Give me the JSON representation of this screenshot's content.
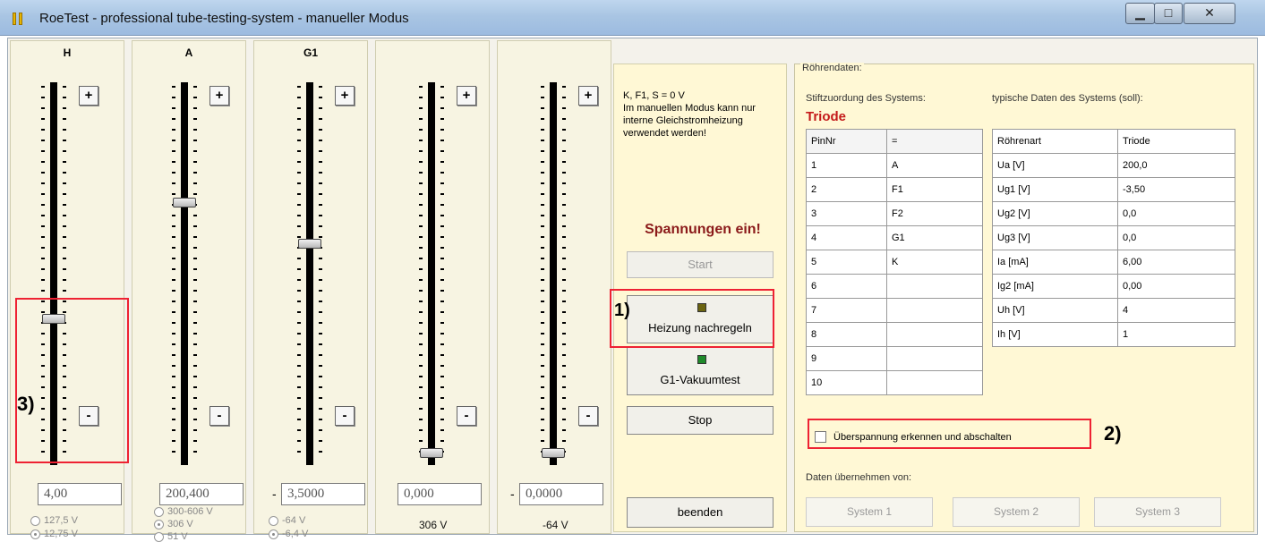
{
  "window": {
    "title": "RoeTest - professional tube-testing-system - manueller Modus",
    "close_symbol": "✕",
    "min_symbol": "▁",
    "max_symbol": "□"
  },
  "sliders": [
    {
      "label": "H",
      "value": "4,00",
      "sign": "",
      "level": 0.62,
      "plus": "+",
      "minus": "-"
    },
    {
      "label": "A",
      "value": "200,400",
      "sign": "",
      "level": 0.31,
      "plus": "+",
      "minus": "-"
    },
    {
      "label": "G1",
      "value": "3,5000",
      "sign": "-",
      "level": 0.42,
      "plus": "+",
      "minus": "-"
    },
    {
      "label": "",
      "value": "0,000",
      "sign": "",
      "level": 0.98,
      "plus": "+",
      "minus": "-"
    },
    {
      "label": "",
      "value": "0,0000",
      "sign": "-",
      "level": 0.98,
      "plus": "+",
      "minus": "-"
    }
  ],
  "ranges": {
    "h": [
      "127,5 V",
      "12,75 V"
    ],
    "a": [
      "300-606 V",
      "306 V",
      "51 V"
    ],
    "g1": [
      "-64 V",
      "-6,4 V"
    ],
    "s4": "306 V",
    "s5": "-64 V"
  },
  "control": {
    "info": "K, F1, S = 0 V\nIm manuellen Modus kann nur interne Gleichstromheizung verwendet werden!",
    "spannungen": "Spannungen ein!",
    "start": "Start",
    "heizung": "Heizung nachregeln",
    "g1_test": "G1-Vakuumtest",
    "stop": "Stop",
    "beenden": "beenden",
    "led_heizung": "#6b6410",
    "led_g1": "#1f8a2a"
  },
  "data": {
    "section": "Röhrendaten:",
    "pin_label": "Stiftzuordung des Systems:",
    "typ_label": "typische Daten des Systems (soll):",
    "system_type": "Triode",
    "pin_header": [
      "PinNr",
      "="
    ],
    "pins": [
      [
        "1",
        "A"
      ],
      [
        "2",
        "F1"
      ],
      [
        "3",
        "F2"
      ],
      [
        "4",
        "G1"
      ],
      [
        "5",
        "K"
      ],
      [
        "6",
        ""
      ],
      [
        "7",
        ""
      ],
      [
        "8",
        ""
      ],
      [
        "9",
        ""
      ],
      [
        "10",
        ""
      ]
    ],
    "props": [
      [
        "Röhrenart",
        "Triode"
      ],
      [
        "Ua [V]",
        "200,0"
      ],
      [
        "Ug1 [V]",
        "-3,50"
      ],
      [
        "Ug2 [V]",
        "0,0"
      ],
      [
        "Ug3 [V]",
        "0,0"
      ],
      [
        "Ia [mA]",
        "6,00"
      ],
      [
        "Ig2 [mA]",
        "0,00"
      ],
      [
        "Uh [V]",
        "4"
      ],
      [
        "Ih [V]",
        "1"
      ]
    ],
    "checkbox": "Überspannung erkennen und abschalten",
    "uebernehmen": "Daten übernehmen von:",
    "systems": [
      "System 1",
      "System 2",
      "System 3"
    ]
  },
  "annotations": [
    "1)",
    "2)",
    "3)"
  ]
}
